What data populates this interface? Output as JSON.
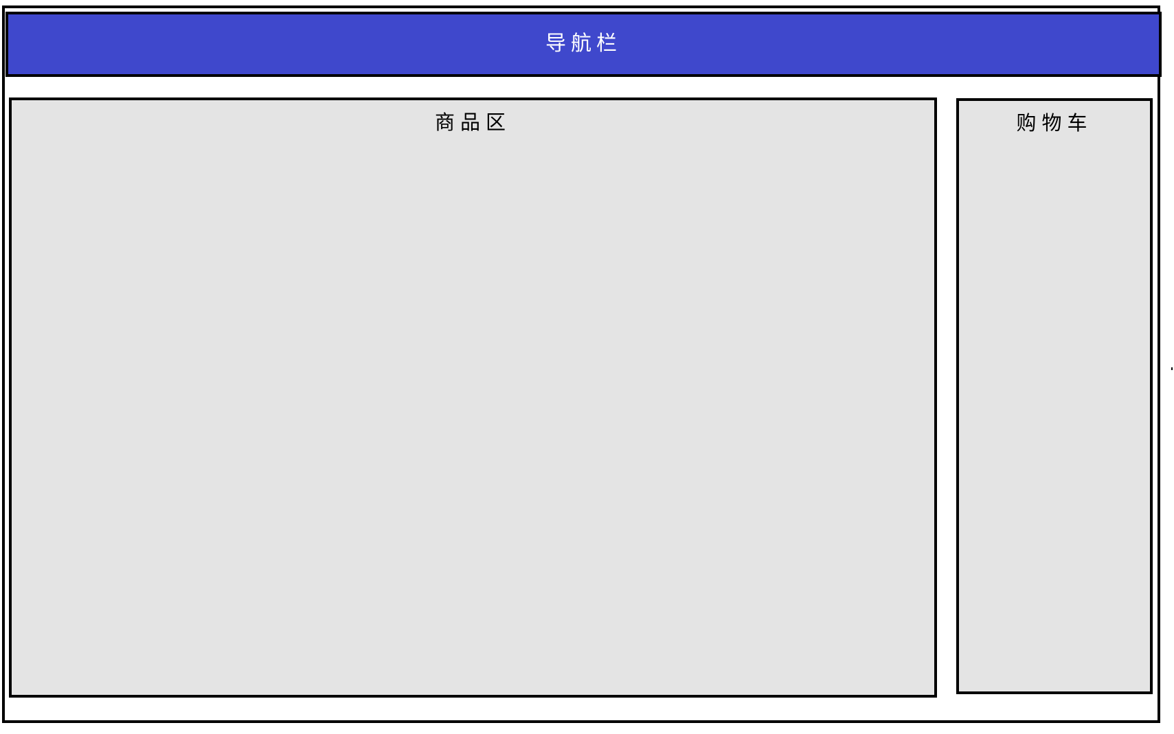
{
  "navigation": {
    "title": "导航栏",
    "background_color": "#3f48cc",
    "text_color": "#ffffff"
  },
  "products": {
    "title": "商品区",
    "background_color": "#e4e4e4"
  },
  "cart": {
    "title": "购物车",
    "background_color": "#e4e4e4"
  },
  "frame": {
    "border_color": "#000000"
  }
}
